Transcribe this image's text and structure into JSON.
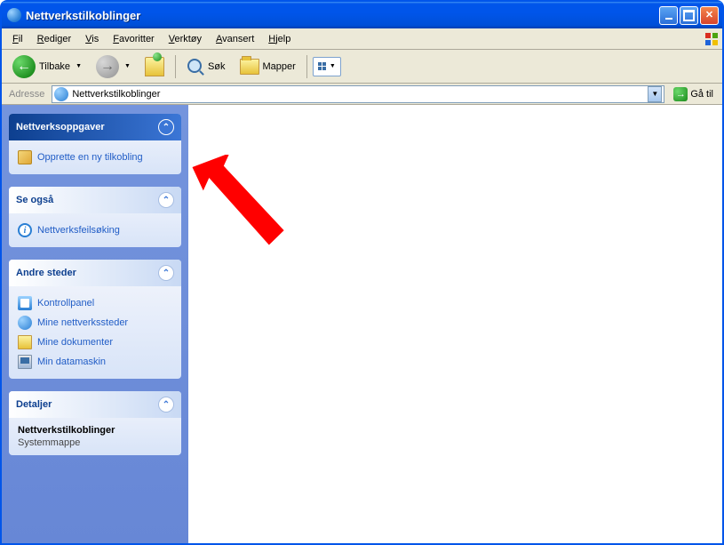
{
  "window": {
    "title": "Nettverkstilkoblinger"
  },
  "menu": {
    "items": [
      {
        "hotkey": "F",
        "rest": "il"
      },
      {
        "hotkey": "R",
        "rest": "ediger"
      },
      {
        "hotkey": "V",
        "rest": "is"
      },
      {
        "hotkey": "F",
        "rest": "avoritter"
      },
      {
        "hotkey": "V",
        "rest": "erktøy"
      },
      {
        "hotkey": "A",
        "rest": "vansert"
      },
      {
        "hotkey": "H",
        "rest": "jelp"
      }
    ]
  },
  "toolbar": {
    "back": "Tilbake",
    "search": "Søk",
    "folders": "Mapper"
  },
  "address": {
    "label": "Adresse",
    "value": "Nettverkstilkoblinger",
    "go": "Gå til"
  },
  "sidebar": {
    "tasks": {
      "title": "Nettverksoppgaver",
      "items": [
        "Opprette en ny tilkobling"
      ]
    },
    "seealso": {
      "title": "Se også",
      "items": [
        "Nettverksfeilsøking"
      ]
    },
    "otherplaces": {
      "title": "Andre steder",
      "items": [
        "Kontrollpanel",
        "Mine nettverkssteder",
        "Mine dokumenter",
        "Min datamaskin"
      ]
    },
    "details": {
      "title": "Detaljer",
      "name": "Nettverkstilkoblinger",
      "type": "Systemmappe"
    }
  }
}
